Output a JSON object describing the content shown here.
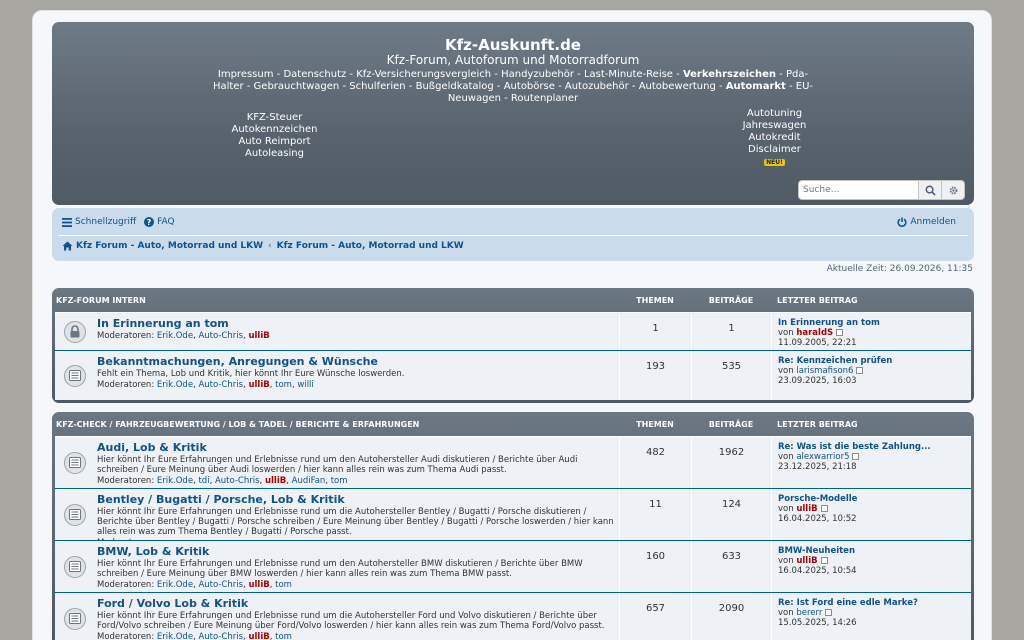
{
  "header": {
    "title": "Kfz-Auskunft.de",
    "subtitle": "Kfz-Forum, Autoforum und Motorradforum",
    "links": [
      {
        "label": "Impressum",
        "bold": false
      },
      {
        "label": "Datenschutz",
        "bold": false
      },
      {
        "label": "Kfz-Versicherungsvergleich",
        "bold": false
      },
      {
        "label": "Handyzubehör",
        "bold": false
      },
      {
        "label": "Last-Minute-Reise",
        "bold": false
      },
      {
        "label": "Verkehrszeichen",
        "bold": true
      },
      {
        "label": "Pda-Halter",
        "bold": false
      },
      {
        "label": "Gebrauchtwagen",
        "bold": false
      },
      {
        "label": "Schulferien",
        "bold": false
      },
      {
        "label": "Bußgeldkatalog",
        "bold": false
      },
      {
        "label": "Autobörse",
        "bold": false
      },
      {
        "label": "Autozubehör",
        "bold": false
      },
      {
        "label": "Autobewertung",
        "bold": false
      },
      {
        "label": "Automarkt",
        "bold": true
      },
      {
        "label": "EU-Neuwagen",
        "bold": false
      },
      {
        "label": "Routenplaner",
        "bold": false
      }
    ],
    "left_links": [
      "KFZ-Steuer",
      "Autokennzeichen",
      "Auto Reimport",
      "Autoleasing"
    ],
    "right_links": [
      "Autotuning",
      "Jahreswagen",
      "Autokredit",
      "Disclaimer"
    ],
    "new_badge": "NEU!",
    "search_placeholder": "Suche…"
  },
  "nav": {
    "quick_access": "Schnellzugriff",
    "faq": "FAQ",
    "login": "Anmelden",
    "breadcrumbs": [
      "Kfz Forum - Auto, Motorrad und LKW",
      "Kfz Forum - Auto, Motorrad und LKW"
    ]
  },
  "current_time": "Aktuelle Zeit: 26.09.2026, 11:35",
  "columns": {
    "topics": "THEMEN",
    "posts": "BEITRÄGE",
    "last_post": "LETZTER BEITRAG"
  },
  "categories": [
    {
      "title": "KFZ-FORUM INTERN",
      "forums": [
        {
          "title": "In Erinnerung an tom",
          "icon": "lock-icon",
          "desc": "",
          "mod_label": "Moderatoren:",
          "mods": [
            "Erik.Ode",
            "Auto-Chris",
            "ulliB"
          ],
          "topics": "1",
          "posts": "1",
          "last_title": "In Erinnerung an tom",
          "last_by_label": "von",
          "last_user": "haraldS",
          "last_user_red": true,
          "last_date": "11.09.2005, 22:21"
        },
        {
          "title": "Bekanntmachungen, Anregungen & Wünsche",
          "icon": "forum-icon",
          "desc": "Fehlt ein Thema, Lob und Kritik, hier könnt Ihr Eure Wünsche loswerden.",
          "mod_label": "Moderatoren:",
          "mods": [
            "Erik.Ode",
            "Auto-Chris",
            "ulliB",
            "tom",
            "willi"
          ],
          "topics": "193",
          "posts": "535",
          "last_title": "Re: Kennzeichen prüfen",
          "last_by_label": "von",
          "last_user": "larismafison6",
          "last_user_red": false,
          "last_date": "23.09.2025, 16:03"
        }
      ]
    },
    {
      "title": "KFZ-CHECK / FAHRZEUGBEWERTUNG / LOB & TADEL / BERICHTE & ERFAHRUNGEN",
      "forums": [
        {
          "title": "Audi, Lob & Kritik",
          "icon": "forum-icon",
          "desc": "Hier könnt Ihr Eure Erfahrungen und Erlebnisse rund um den Autohersteller Audi diskutieren / Berichte über Audi schreiben / Eure Meinung über Audi loswerden / hier kann alles rein was zum Thema Audi passt.",
          "mod_label": "Moderatoren:",
          "mods": [
            "Erik.Ode",
            "tdi",
            "Auto-Chris",
            "ulliB",
            "AudiFan",
            "tom"
          ],
          "topics": "482",
          "posts": "1962",
          "last_title": "Re: Was ist die beste Zahlung...",
          "last_by_label": "von",
          "last_user": "alexwarrior5",
          "last_user_red": false,
          "last_date": "23.12.2025, 21:18"
        },
        {
          "title": "Bentley / Bugatti / Porsche, Lob & Kritik",
          "icon": "forum-icon",
          "desc": "Hier könnt Ihr Eure Erfahrungen und Erlebnisse rund um die Autohersteller Bentley / Bugatti / Porsche diskutieren / Berichte über Bentley / Bugatti / Porsche schreiben / Eure Meinung über Bentley / Bugatti / Porsche loswerden / hier kann alles rein was zum Thema Bentley / Bugatti / Porsche passt.",
          "mod_label": "Moderatoren:",
          "mods": [],
          "topics": "11",
          "posts": "124",
          "last_title": "Porsche-Modelle",
          "last_by_label": "von",
          "last_user": "ulliB",
          "last_user_red": true,
          "last_date": "16.04.2025, 10:52"
        },
        {
          "title": "BMW, Lob & Kritik",
          "icon": "forum-icon",
          "desc": "Hier könnt Ihr Eure Erfahrungen und Erlebnisse rund um den Autohersteller BMW diskutieren / Berichte über BMW schreiben / Eure Meinung über BMW loswerden / hier kann alles rein was zum Thema BMW passt.",
          "mod_label": "Moderatoren:",
          "mods": [
            "Erik.Ode",
            "Auto-Chris",
            "ulliB",
            "tom"
          ],
          "topics": "160",
          "posts": "633",
          "last_title": "BMW-Neuheiten",
          "last_by_label": "von",
          "last_user": "ulliB",
          "last_user_red": true,
          "last_date": "16.04.2025, 10:54"
        },
        {
          "title": "Ford / Volvo Lob & Kritik",
          "icon": "forum-icon",
          "desc": "Hier könnt Ihr Eure Erfahrungen und Erlebnisse rund um die Autohersteller Ford und Volvo diskutieren / Berichte über Ford/Volvo schreiben / Eure Meinung über Ford/Volvo loswerden / hier kann alles rein was zum Thema Ford/Volvo passt.",
          "mod_label": "Moderatoren:",
          "mods": [
            "Erik.Ode",
            "Auto-Chris",
            "ulliB",
            "tom"
          ],
          "topics": "657",
          "posts": "2090",
          "last_title": "Re: Ist Ford eine edle Marke?",
          "last_by_label": "von",
          "last_user": "bererr",
          "last_user_red": false,
          "last_date": "15.05.2025, 14:26"
        }
      ]
    }
  ]
}
